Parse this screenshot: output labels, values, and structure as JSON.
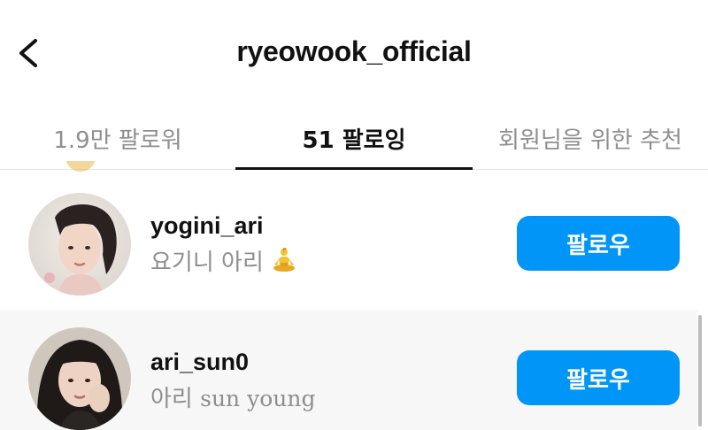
{
  "header": {
    "title": "ryeowook_official",
    "back_icon": "chevron-left-icon"
  },
  "tabs": [
    {
      "label": "1.9만 팔로워",
      "active": false
    },
    {
      "label": "51 팔로잉",
      "active": true
    },
    {
      "label": "회원님을 위한 추천",
      "active": false
    }
  ],
  "users": [
    {
      "username": "yogini_ari",
      "subname": "요기니 아리",
      "emoji_icon": "meditating-person-emoji",
      "button_label": "팔로우"
    },
    {
      "username": "ari_sun0",
      "subname_korean": "아리",
      "subname_latin": "sun young",
      "button_label": "팔로우"
    }
  ],
  "colors": {
    "accent": "#0095f6",
    "muted_text": "#8e8e8e",
    "primary_text": "#111111"
  }
}
